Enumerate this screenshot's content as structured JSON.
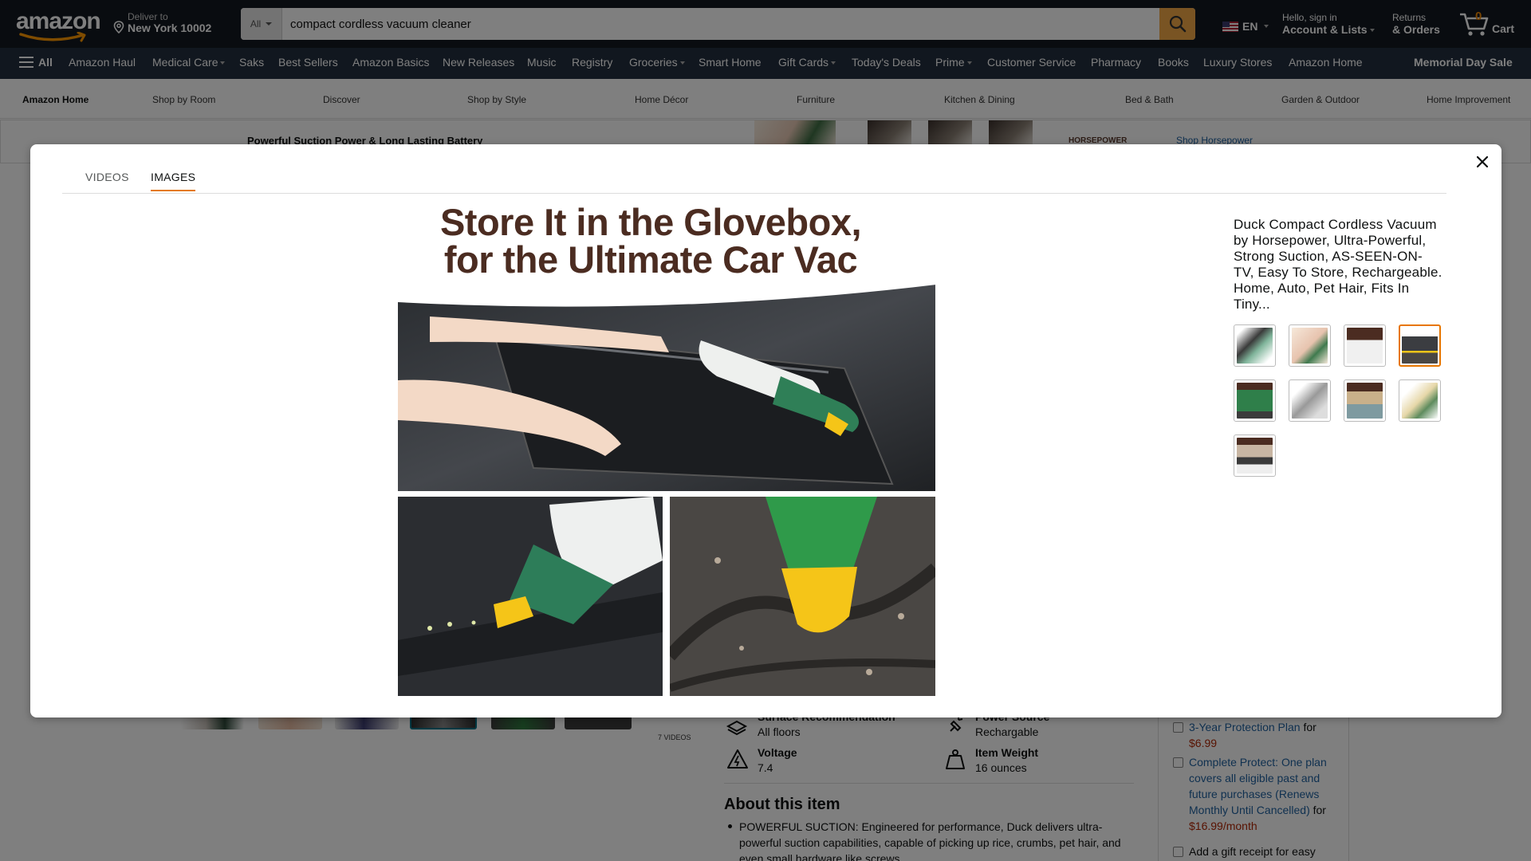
{
  "header": {
    "logo_text": "amazon",
    "deliver_label": "Deliver to",
    "deliver_location": "New York 10002",
    "search_category": "All",
    "search_value": "compact cordless vacuum cleaner",
    "language": "EN",
    "account_greeting": "Hello, sign in",
    "account_label": "Account & Lists",
    "returns_label": "Returns",
    "orders_label": "& Orders",
    "cart_count": "0",
    "cart_label": "Cart"
  },
  "main_nav": {
    "all_label": "All",
    "items": [
      "Amazon Haul",
      "Medical Care",
      "Saks",
      "Best Sellers",
      "Amazon Basics",
      "New Releases",
      "Music",
      "Registry",
      "Groceries",
      "Smart Home",
      "Gift Cards",
      "Today's Deals",
      "Prime",
      "Customer Service",
      "Pharmacy",
      "Books",
      "Luxury Stores",
      "Amazon Home"
    ],
    "sale_label": "Memorial Day Sale"
  },
  "sub_nav": {
    "items": [
      "Amazon Home",
      "Shop by Room",
      "Discover",
      "Shop by Style",
      "Home Décor",
      "Furniture",
      "Kitchen & Dining",
      "Bed & Bath",
      "Garden & Outdoor",
      "Home Improvement"
    ]
  },
  "banner": {
    "text": "Powerful Suction Power & Long Lasting Battery",
    "brand": "HORSEPOWER",
    "link": "Shop Horsepower"
  },
  "modal": {
    "tabs": [
      {
        "label": "VIDEOS",
        "active": false
      },
      {
        "label": "IMAGES",
        "active": true
      }
    ],
    "headline_line1": "Store It in the Glovebox,",
    "headline_line2": "for the Ultimate Car Vac",
    "product_title": "Duck Compact Cordless Vacuum by Horsepower, Ultra-Powerful, Strong Suction, AS-SEEN-ON-TV, Easy To Store, Rechargeable. Home, Auto, Pet Hair, Fits In Tiny...",
    "selected_thumbnail_index": 3,
    "thumbnail_count": 9
  },
  "background_page": {
    "videos_label": "7 VIDEOS",
    "specs": [
      {
        "label": "Surface Recommendation",
        "value": "All floors"
      },
      {
        "label": "Power Source",
        "value": "Rechargable"
      },
      {
        "label": "Voltage",
        "value": "7.4"
      },
      {
        "label": "Item Weight",
        "value": "16 ounces"
      }
    ],
    "about_title": "About this item",
    "about_text": "POWERFUL SUCTION: Engineered for performance, Duck delivers ultra-powerful suction capabilities, capable of picking up rice, crumbs, pet hair, and even small hardware like screws.",
    "buybox": {
      "protection_link": "3-Year Protection Plan",
      "protection_for": "for",
      "protection_price": "$6.99",
      "complete_link": "Complete Protect: One plan covers all eligible past and future purchases (Renews Monthly Until Cancelled)",
      "complete_for": "for",
      "complete_price": "$16.99/month",
      "gift_label": "Add a gift receipt for easy"
    }
  },
  "colors": {
    "nav_dark": "#131921",
    "nav_secondary": "#232f3e",
    "search_button": "#f3a847",
    "accent_orange": "#e77600",
    "headline_brown": "#4b2c21",
    "link_blue": "#2162a1",
    "price_red": "#b12704"
  }
}
